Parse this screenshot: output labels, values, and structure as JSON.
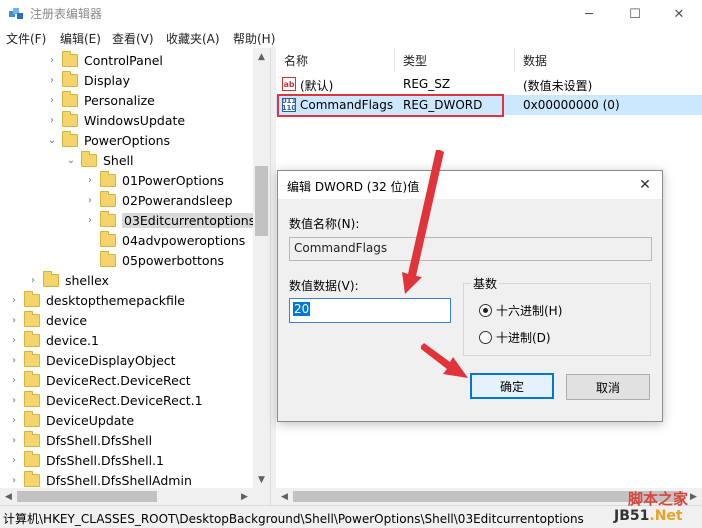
{
  "window": {
    "title": "注册表编辑器",
    "controls": {
      "minimize": "─",
      "maximize": "☐",
      "close": "✕"
    }
  },
  "menu": [
    "文件(F)",
    "编辑(E)",
    "查看(V)",
    "收藏夹(A)",
    "帮助(H)"
  ],
  "tree": {
    "items": [
      {
        "label": "ControlPanel",
        "arrow": "›"
      },
      {
        "label": "Display",
        "arrow": "›"
      },
      {
        "label": "Personalize",
        "arrow": "›"
      },
      {
        "label": "WindowsUpdate",
        "arrow": "›"
      },
      {
        "label": "PowerOptions",
        "arrow": "⌄"
      },
      {
        "label": "Shell",
        "arrow": "⌄"
      },
      {
        "label": "01PowerOptions",
        "arrow": "›"
      },
      {
        "label": "02Powerandsleep",
        "arrow": "›"
      },
      {
        "label": "03Editcurrentoptions",
        "arrow": "›"
      },
      {
        "label": "04advpoweroptions",
        "arrow": ""
      },
      {
        "label": "05powerbottons",
        "arrow": ""
      },
      {
        "label": "shellex",
        "arrow": "›"
      },
      {
        "label": "desktopthemepackfile",
        "arrow": "›"
      },
      {
        "label": "device",
        "arrow": "›"
      },
      {
        "label": "device.1",
        "arrow": "›"
      },
      {
        "label": "DeviceDisplayObject",
        "arrow": "›"
      },
      {
        "label": "DeviceRect.DeviceRect",
        "arrow": "›"
      },
      {
        "label": "DeviceRect.DeviceRect.1",
        "arrow": "›"
      },
      {
        "label": "DeviceUpdate",
        "arrow": "›"
      },
      {
        "label": "DfsShell.DfsShell",
        "arrow": "›"
      },
      {
        "label": "DfsShell.DfsShell.1",
        "arrow": "›"
      },
      {
        "label": "DfsShell.DfsShellAdmin",
        "arrow": "›"
      }
    ],
    "selected": "03Editcurrentoptions"
  },
  "values_pane": {
    "columns": [
      "名称",
      "类型",
      "数据"
    ],
    "rows": [
      {
        "icon": "ab",
        "name": "(默认)",
        "type": "REG_SZ",
        "data": "(数值未设置)"
      },
      {
        "icon": "011 110",
        "name": "CommandFlags",
        "type": "REG_DWORD",
        "data": "0x00000000 (0)"
      }
    ]
  },
  "status_path": "计算机\\HKEY_CLASSES_ROOT\\DesktopBackground\\Shell\\PowerOptions\\Shell\\03Editcurrentoptions",
  "dialog": {
    "title": "编辑 DWORD (32 位)值",
    "close": "✕",
    "name_label": "数值名称(N):",
    "name_value": "CommandFlags",
    "data_label": "数值数据(V):",
    "data_value": "20",
    "base_label": "基数",
    "base_options": [
      "十六进制(H)",
      "十进制(D)"
    ],
    "base_selected": "十六进制(H)",
    "ok": "确定",
    "cancel": "取消"
  },
  "annotation_color": "#e0343a",
  "selection_color": "#cce8ff",
  "watermark": {
    "line1": "脚本之家",
    "line2a": "JB51",
    "line2b": ".Net"
  }
}
